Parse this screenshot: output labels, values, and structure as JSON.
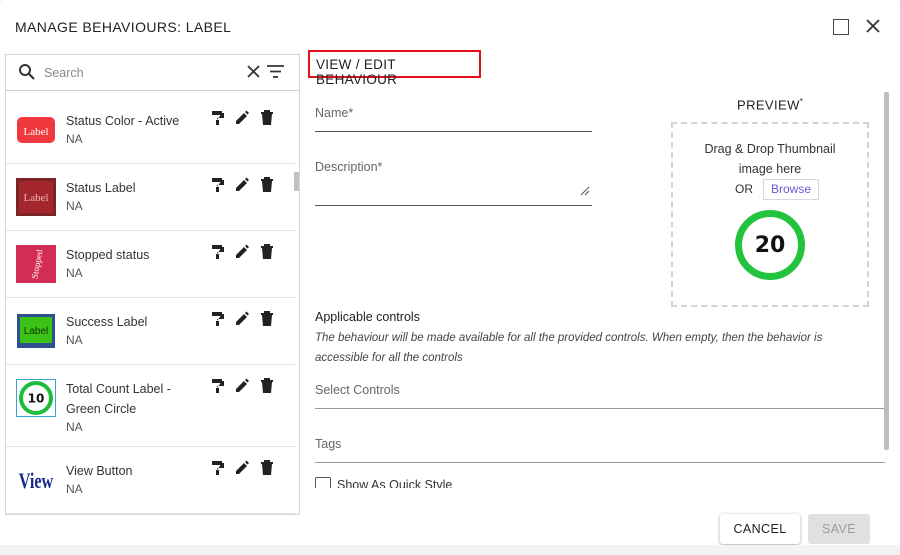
{
  "dialog": {
    "title": "MANAGE BEHAVIOURS: LABEL",
    "maximize_icon": "maximize-icon",
    "close_icon": "close-icon"
  },
  "search": {
    "placeholder": "Search",
    "value": "",
    "icons": [
      "search-icon",
      "clear-icon",
      "filter-icon"
    ]
  },
  "behaviours": {
    "item_actions": [
      "paint-roller-icon",
      "pencil-icon",
      "trash-icon"
    ],
    "items": [
      {
        "name": "Status Color - Active",
        "sub": "NA",
        "thumb_text": "Label",
        "thumb_color": "#f0393f"
      },
      {
        "name": "Status Label",
        "sub": "NA",
        "thumb_text": "Label",
        "thumb_color": "#a3272c"
      },
      {
        "name": "Stopped status",
        "sub": "NA",
        "thumb_text": "Stopped",
        "thumb_color": "#d42d55"
      },
      {
        "name": "Success Label",
        "sub": "NA",
        "thumb_text": "Label",
        "thumb_color": "#3cc116"
      },
      {
        "name": "Total Count Label - Green Circle",
        "sub": "NA",
        "thumb_text": "10",
        "thumb_color": "#1bbd3a"
      },
      {
        "name": "View Button",
        "sub": "NA",
        "thumb_text": "View",
        "thumb_color": "#1a2a8c"
      }
    ]
  },
  "editor": {
    "section_title": "VIEW / EDIT BEHAVIOUR",
    "name_label": "Name*",
    "name_value": "",
    "description_label": "Description*",
    "description_value": "",
    "applicable_title": "Applicable controls",
    "applicable_desc": "The behaviour will be made available for all the provided controls. When empty, then the behavior is accessible for all the controls",
    "select_controls_placeholder": "Select Controls",
    "tags_placeholder": "Tags",
    "quick_style_label": "Show As Quick Style",
    "quick_style_checked": false
  },
  "preview": {
    "title": "PREVIEW",
    "required_mark": "*",
    "drop_line1": "Drag & Drop Thumbnail",
    "drop_line2": "image here",
    "or_text": "OR",
    "browse_label": "Browse",
    "circle_value": "20",
    "circle_color": "#21c43c"
  },
  "footer": {
    "cancel_label": "CANCEL",
    "save_label": "SAVE",
    "save_enabled": false
  },
  "colors": {
    "accent_border": "#e0101a",
    "browse_text": "#6b5ad0"
  }
}
